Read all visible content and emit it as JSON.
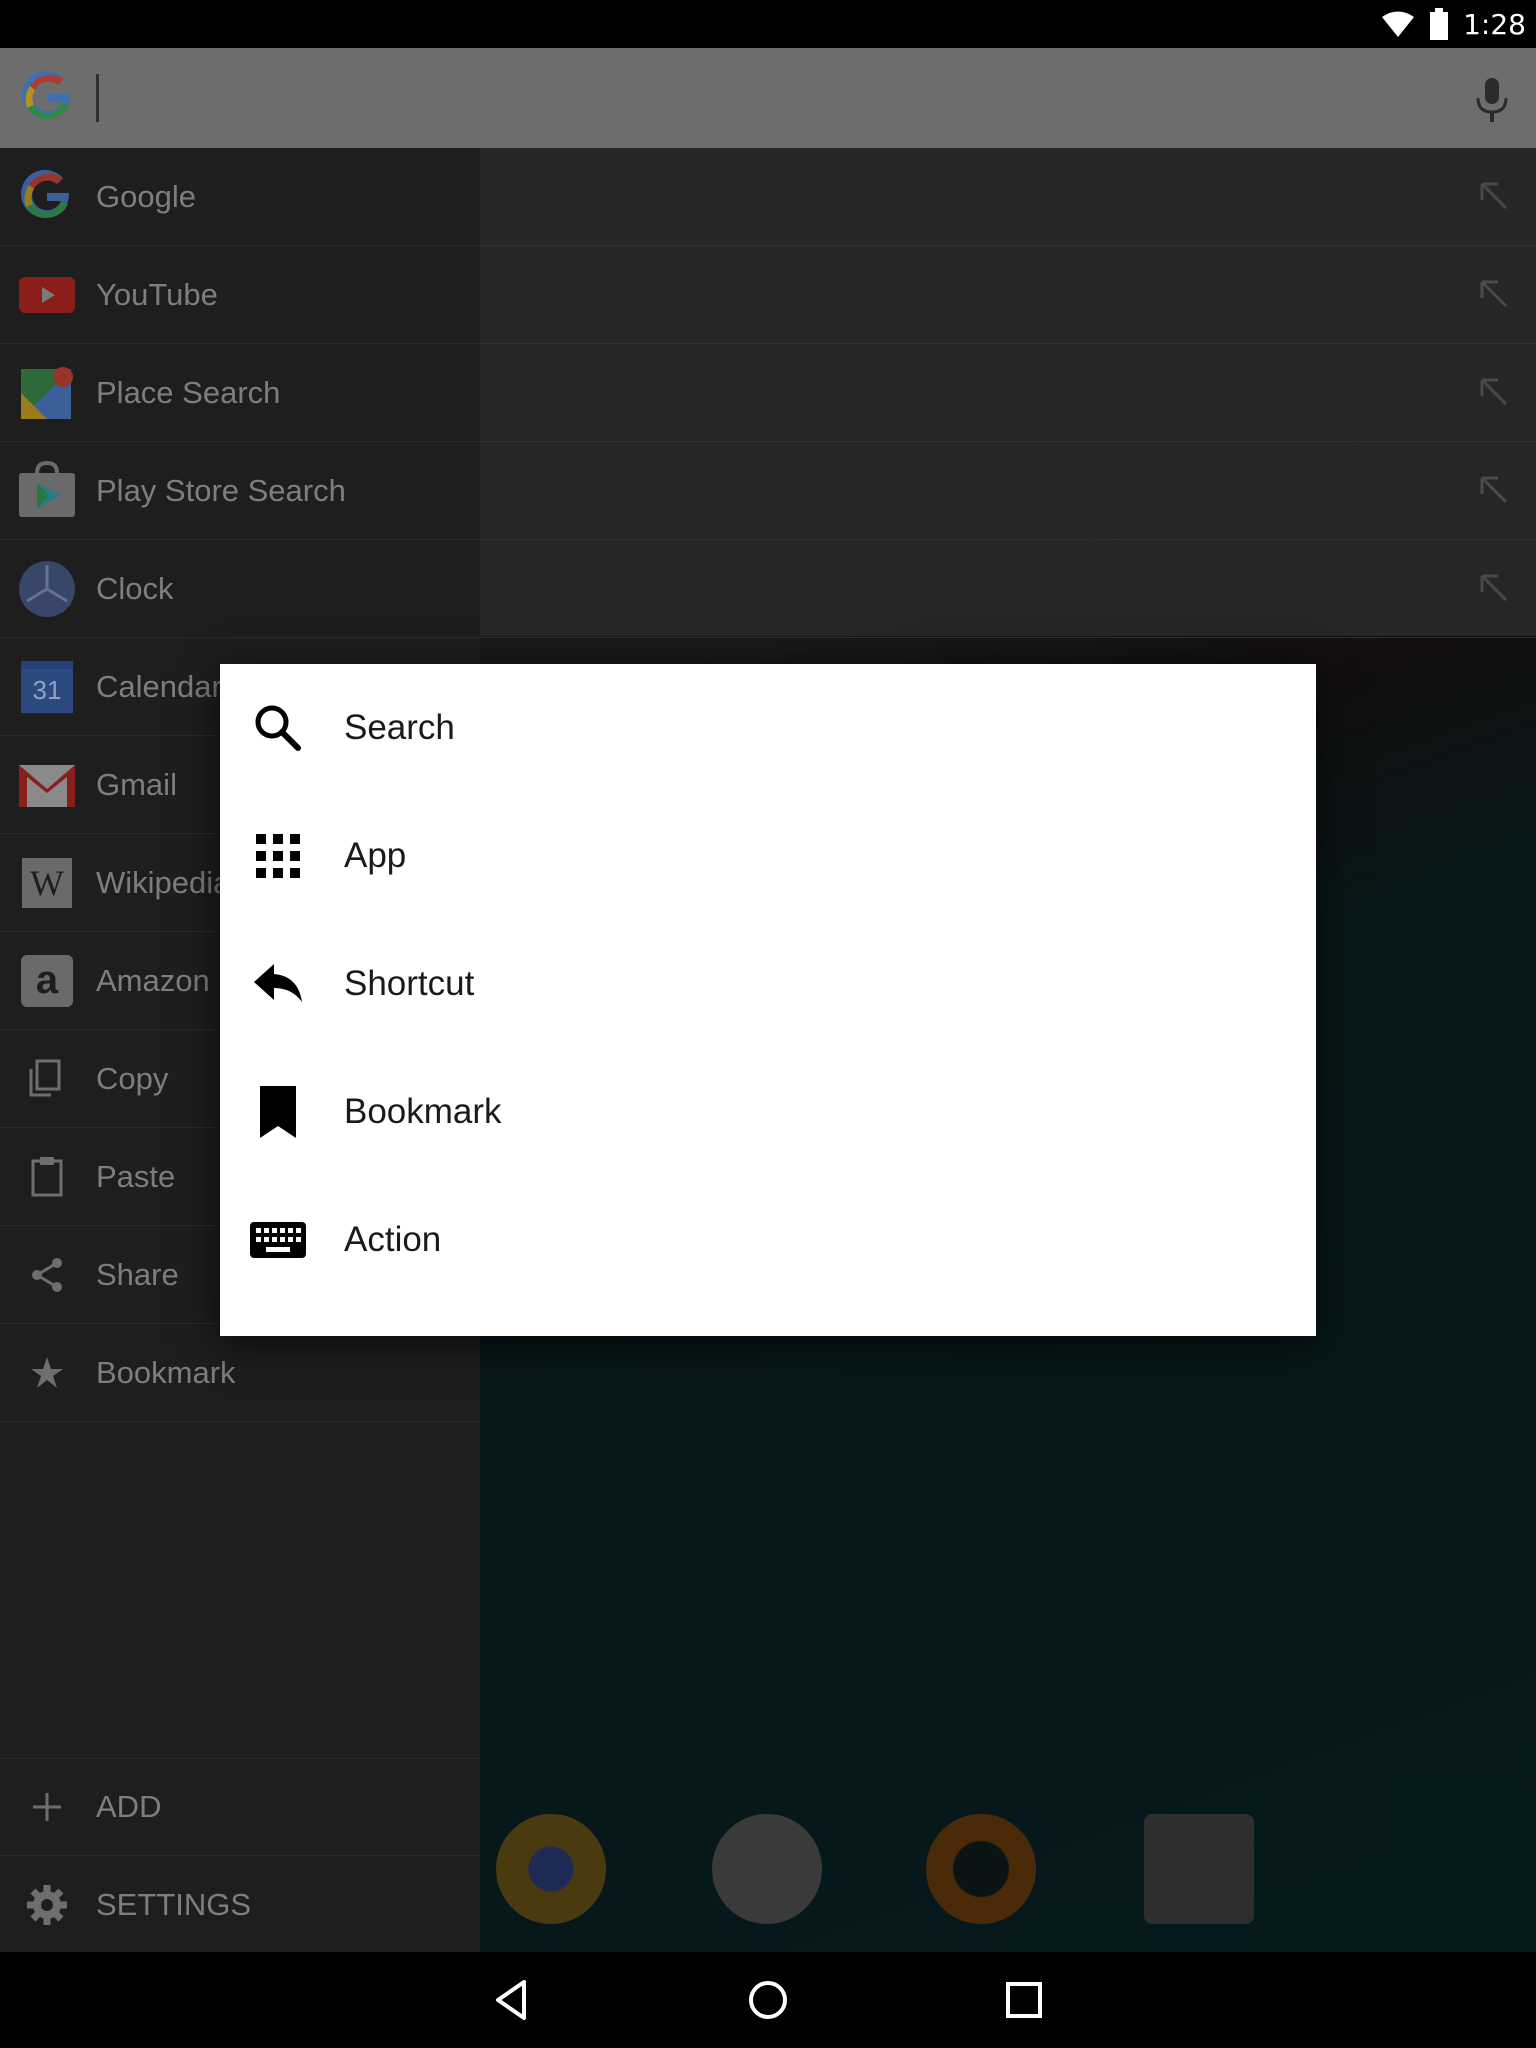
{
  "status_bar": {
    "time": "1:28",
    "icons": [
      "wifi-icon",
      "battery-icon"
    ]
  },
  "search": {
    "value": "",
    "logo": "google-g-icon",
    "voice_icon": "mic-icon"
  },
  "drawer": {
    "items": [
      {
        "label": "Google",
        "icon": "google-g-icon"
      },
      {
        "label": "YouTube",
        "icon": "youtube-icon"
      },
      {
        "label": "Place Search",
        "icon": "maps-icon"
      },
      {
        "label": "Play Store Search",
        "icon": "play-store-icon"
      },
      {
        "label": "Clock",
        "icon": "clock-icon"
      },
      {
        "label": "Calendar",
        "icon": "calendar-icon",
        "badge": "31"
      },
      {
        "label": "Gmail",
        "icon": "gmail-icon"
      },
      {
        "label": "Wikipedia",
        "icon": "wikipedia-icon",
        "badge": "W"
      },
      {
        "label": "Amazon",
        "icon": "amazon-icon",
        "badge": "a"
      },
      {
        "label": "Copy",
        "icon": "copy-icon"
      },
      {
        "label": "Paste",
        "icon": "paste-icon"
      },
      {
        "label": "Share",
        "icon": "share-icon"
      },
      {
        "label": "Bookmark",
        "icon": "star-icon"
      }
    ],
    "footer": [
      {
        "label": "ADD",
        "icon": "plus-icon"
      },
      {
        "label": "SETTINGS",
        "icon": "gear-icon"
      }
    ]
  },
  "dialog": {
    "items": [
      {
        "label": "Search",
        "icon": "search-icon"
      },
      {
        "label": "App",
        "icon": "apps-grid-icon"
      },
      {
        "label": "Shortcut",
        "icon": "reply-arrow-icon"
      },
      {
        "label": "Bookmark",
        "icon": "bookmark-icon"
      },
      {
        "label": "Action",
        "icon": "keyboard-icon"
      }
    ]
  },
  "nav": {
    "buttons": [
      "back-icon",
      "home-icon",
      "recents-icon"
    ]
  },
  "colors": {
    "dialog_bg": "#ffffff",
    "drawer_bg": "#1e1e1e",
    "search_bar": "#6d6d6d"
  }
}
